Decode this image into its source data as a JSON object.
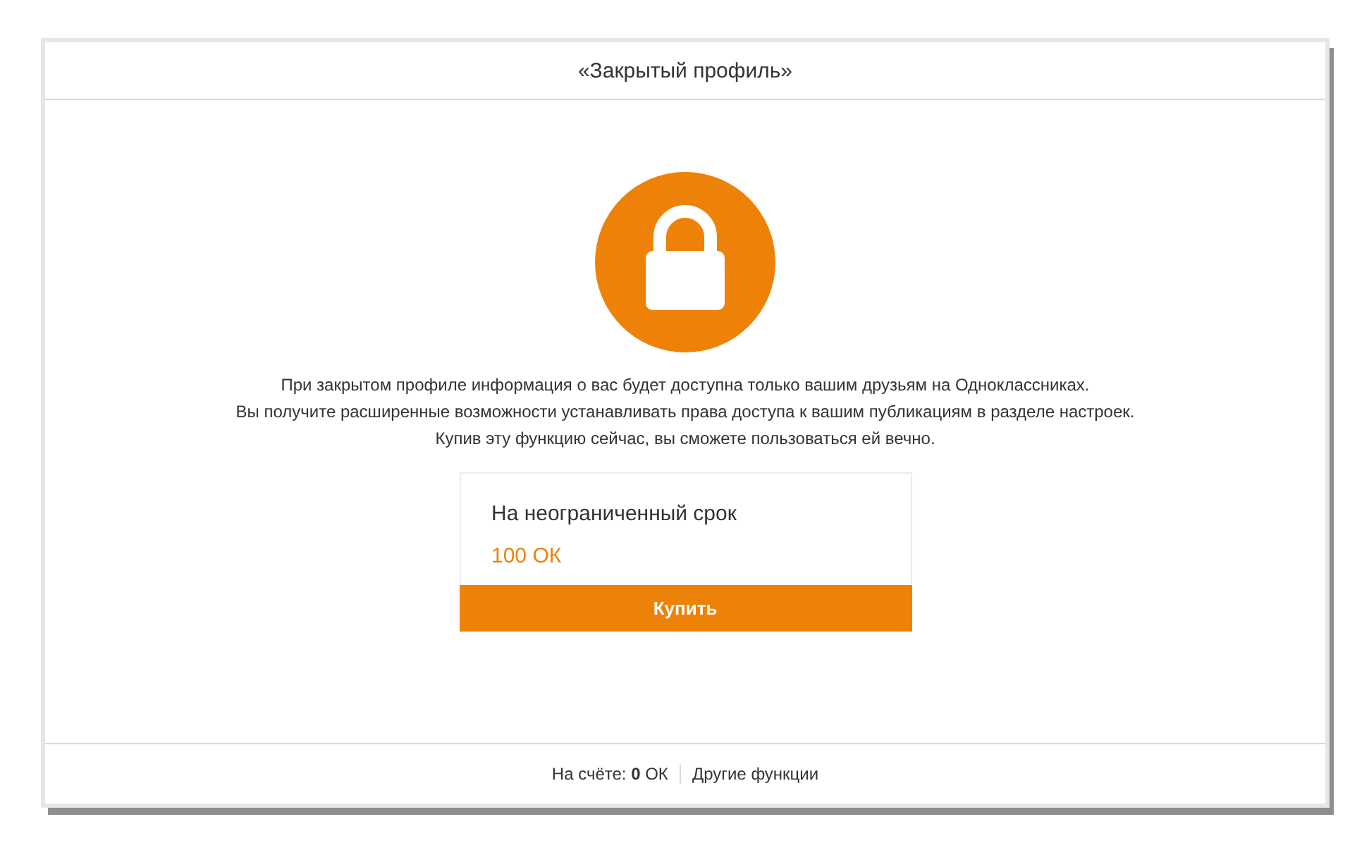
{
  "dialog": {
    "title": "«Закрытый профиль»"
  },
  "description": [
    "При закрытом профиле информация о вас будет доступна только вашим друзьям на Одноклассниках.",
    "Вы получите расширенные возможности устанавливать права доступа к вашим публикациям в разделе настроек.",
    "Купив эту функцию сейчас, вы сможете пользоваться ей вечно."
  ],
  "offer": {
    "term": "На неограниченный срок",
    "price": "100 ОК",
    "button": "Купить"
  },
  "footer": {
    "balance": "На счёте: **0** ОК",
    "link": "Другие функции"
  }
}
